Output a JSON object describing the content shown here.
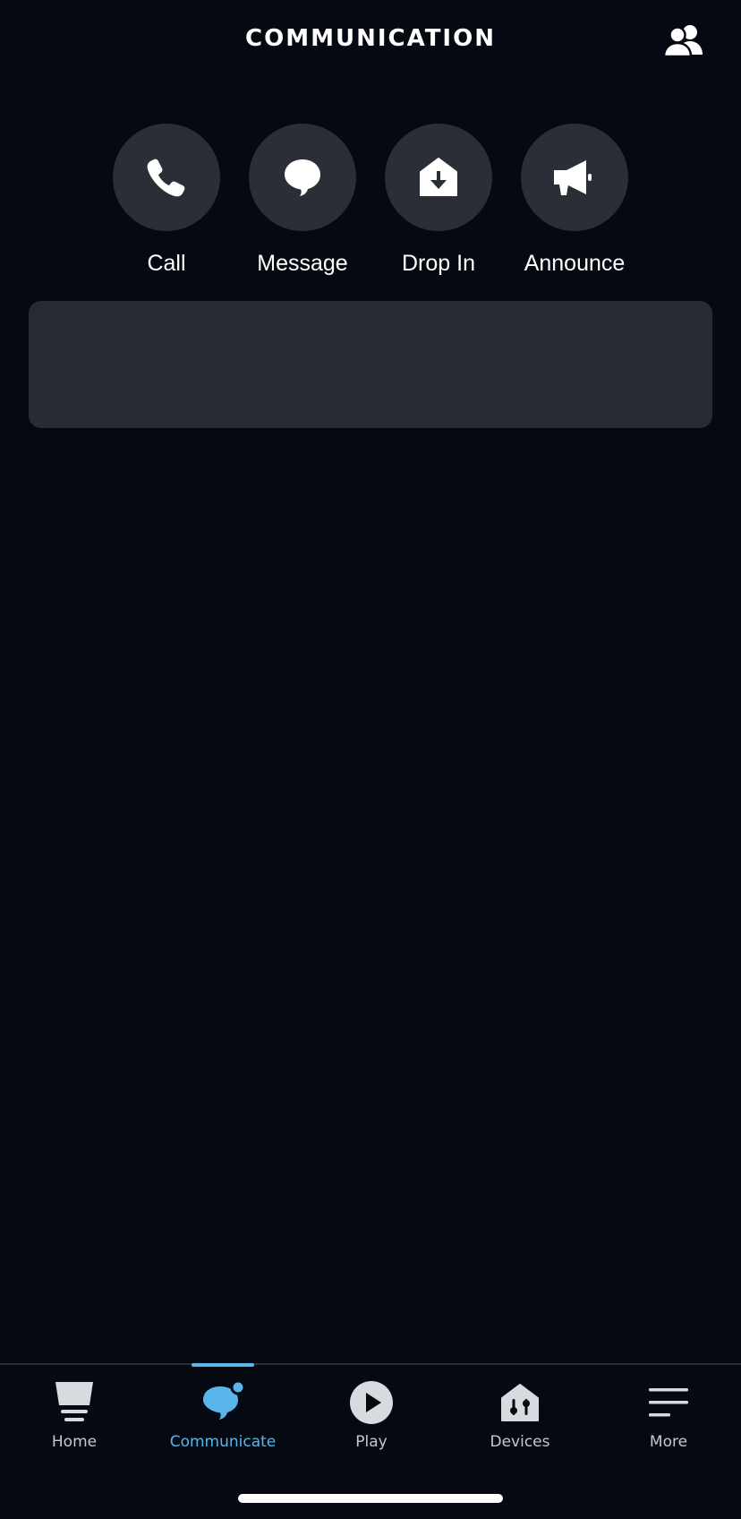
{
  "header": {
    "title": "COMMUNICATION",
    "contacts_icon": "contacts-icon"
  },
  "actions": [
    {
      "label": "Call",
      "icon": "phone-icon"
    },
    {
      "label": "Message",
      "icon": "speech-bubble-icon"
    },
    {
      "label": "Drop In",
      "icon": "drop-in-house-icon"
    },
    {
      "label": "Announce",
      "icon": "megaphone-icon"
    }
  ],
  "bottom_nav": {
    "items": [
      {
        "label": "Home",
        "icon": "home-icon",
        "active": false
      },
      {
        "label": "Communicate",
        "icon": "communicate-icon",
        "active": true
      },
      {
        "label": "Play",
        "icon": "play-icon",
        "active": false
      },
      {
        "label": "Devices",
        "icon": "devices-icon",
        "active": false
      },
      {
        "label": "More",
        "icon": "menu-icon",
        "active": false
      }
    ]
  },
  "colors": {
    "background": "#050a12",
    "circle": "#2a2f37",
    "card": "#272c34",
    "accent": "#5ab6ea",
    "nav_text": "#c5c9cf"
  }
}
